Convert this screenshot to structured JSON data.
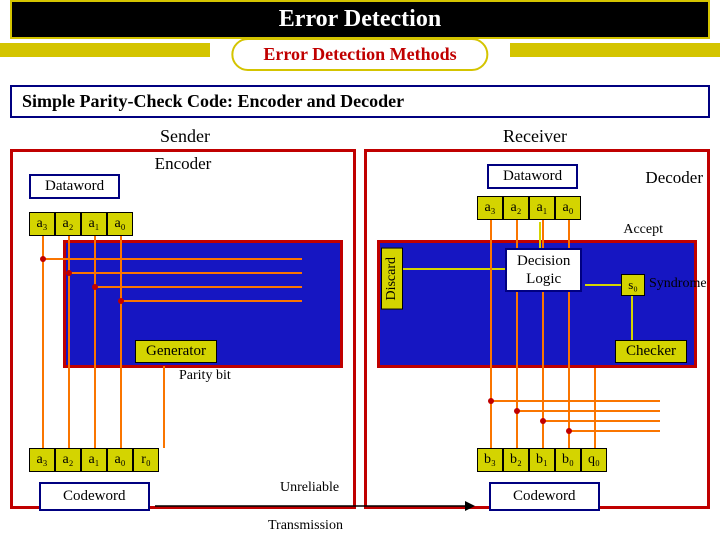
{
  "title": "Error Detection",
  "subtitle": "Error Detection Methods",
  "section": "Simple Parity-Check Code: Encoder and Decoder",
  "roles": {
    "sender": "Sender",
    "receiver": "Receiver"
  },
  "encoder": {
    "label": "Encoder",
    "dataword": "Dataword",
    "bits": [
      "a₃",
      "a₂",
      "a₁",
      "a₀"
    ],
    "generator": "Generator",
    "parity": "Parity bit",
    "codebits": [
      "a₃",
      "a₂",
      "a₁",
      "a₀",
      "r₀"
    ],
    "codeword": "Codeword"
  },
  "decoder": {
    "label": "Decoder",
    "dataword": "Dataword",
    "bits": [
      "a₃",
      "a₂",
      "a₁",
      "a₀"
    ],
    "accept": "Accept",
    "discard": "Discard",
    "decision_l1": "Decision",
    "decision_l2": "Logic",
    "checker": "Checker",
    "syndrome": "Syndrome",
    "s0": "s₀",
    "codebits": [
      "b₃",
      "b₂",
      "b₁",
      "b₀",
      "q₀"
    ],
    "codeword": "Codeword"
  },
  "link": {
    "unreliable": "Unreliable",
    "transmission": "Transmission"
  },
  "chart_data": {
    "type": "table",
    "title": "Simple Parity-Check Code: Encoder and Decoder block diagram",
    "sender": {
      "role": "Encoder",
      "dataword_bits": [
        "a3",
        "a2",
        "a1",
        "a0"
      ],
      "block": "Generator",
      "parity_output": "r0",
      "codeword_bits": [
        "a3",
        "a2",
        "a1",
        "a0",
        "r0"
      ]
    },
    "receiver": {
      "role": "Decoder",
      "codeword_bits": [
        "b3",
        "b2",
        "b1",
        "b0",
        "q0"
      ],
      "block": "Checker",
      "syndrome_output": "s0",
      "decision_block": "Decision Logic",
      "decision_outcomes": [
        "Accept",
        "Discard"
      ],
      "dataword_bits": [
        "a3",
        "a2",
        "a1",
        "a0"
      ]
    },
    "channel": "Unreliable Transmission"
  }
}
